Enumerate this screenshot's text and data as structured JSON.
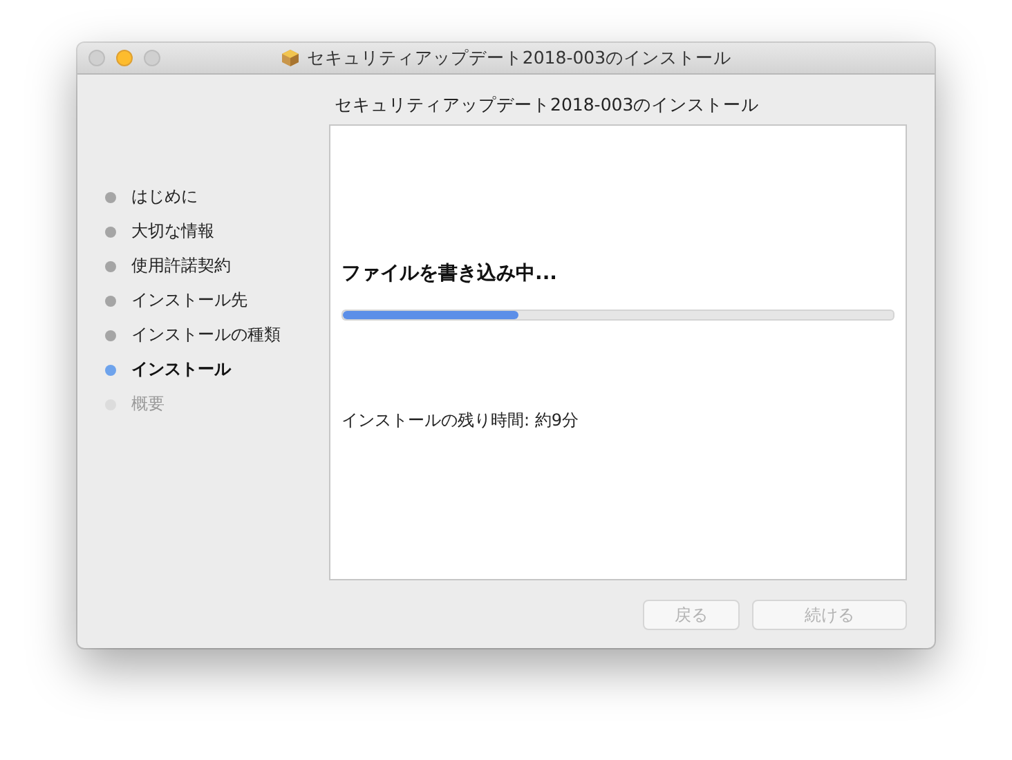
{
  "window": {
    "title": "セキュリティアップデート2018-003のインストール"
  },
  "header": "セキュリティアップデート2018-003のインストール",
  "steps": [
    {
      "label": "はじめに",
      "selected": false,
      "disabled": false
    },
    {
      "label": "大切な情報",
      "selected": false,
      "disabled": false
    },
    {
      "label": "使用許諾契約",
      "selected": false,
      "disabled": false
    },
    {
      "label": "インストール先",
      "selected": false,
      "disabled": false
    },
    {
      "label": "インストールの種類",
      "selected": false,
      "disabled": false
    },
    {
      "label": "インストール",
      "selected": true,
      "disabled": false
    },
    {
      "label": "概要",
      "selected": false,
      "disabled": true
    }
  ],
  "progress": {
    "heading": "ファイルを書き込み中...",
    "level": 0.32,
    "remaining": "インストールの残り時間: 約9分"
  },
  "buttons": [
    {
      "label": "戻る",
      "disabled": true
    },
    {
      "label": "続ける",
      "disabled": true
    }
  ]
}
